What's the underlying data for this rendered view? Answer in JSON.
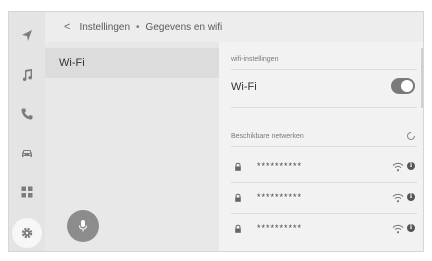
{
  "breadcrumb": {
    "back_label": "<",
    "parent": "Instellingen",
    "separator": "•",
    "current": "Gegevens en wifi"
  },
  "sidebar": {
    "icons": [
      "navigation-icon",
      "music-icon",
      "phone-icon",
      "car-icon",
      "apps-icon",
      "settings-icon"
    ],
    "active": "settings-icon"
  },
  "left_menu": {
    "items": [
      {
        "label": "Wi-Fi",
        "selected": true
      }
    ]
  },
  "right_panel": {
    "section_wifi": "wifi-instellingen",
    "wifi_label": "Wi-Fi",
    "wifi_enabled": true,
    "section_networks": "Beschikbare netwerken",
    "networks": [
      {
        "ssid": "**********",
        "locked": true
      },
      {
        "ssid": "**********",
        "locked": true
      },
      {
        "ssid": "**********",
        "locked": true
      }
    ],
    "info_glyph": "i"
  },
  "colors": {
    "toggle_on": "#7a7a7a",
    "mic_button": "#8c8c8c",
    "selected_item": "#dcdcdc"
  }
}
